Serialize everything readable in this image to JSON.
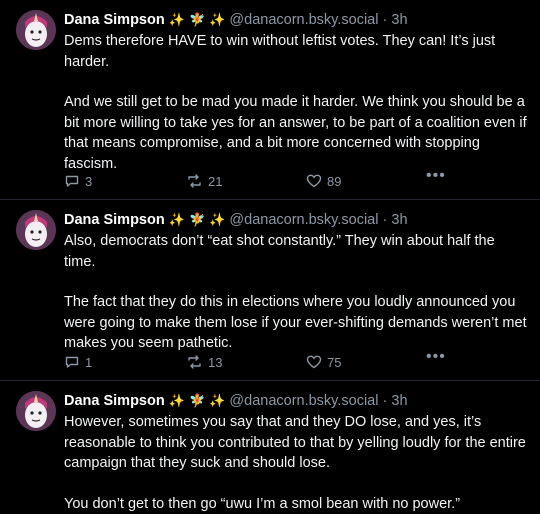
{
  "posts": [
    {
      "name": "Dana Simpson",
      "emoji": [
        "✨",
        "🧚",
        "✨"
      ],
      "handle": "@danacorn.bsky.social",
      "time": "3h",
      "paragraphs": [
        "Dems therefore HAVE to win without leftist votes. They can! It’s just harder.",
        "And we still get to be mad you made it harder. We think you should be a bit more willing to take yes for an answer, to be part of a coalition even if that means compromise, and a bit more concerned with stopping fascism."
      ],
      "replies": "3",
      "reposts": "21",
      "likes": "89"
    },
    {
      "name": "Dana Simpson",
      "emoji": [
        "✨",
        "🧚",
        "✨"
      ],
      "handle": "@danacorn.bsky.social",
      "time": "3h",
      "paragraphs": [
        "Also, democrats don’t “eat shot constantly.” They win about half the time.",
        "The fact that they do this in elections where you loudly announced you were going to make them lose if your ever-shifting demands weren’t met makes you seem pathetic."
      ],
      "replies": "1",
      "reposts": "13",
      "likes": "75"
    },
    {
      "name": "Dana Simpson",
      "emoji": [
        "✨",
        "🧚",
        "✨"
      ],
      "handle": "@danacorn.bsky.social",
      "time": "3h",
      "paragraphs": [
        "However, sometimes you say that and they DO lose, and yes, it’s reasonable to think you contributed to that by yelling loudly for the entire campaign that they suck and should lose.",
        "You don’t get to then go “uwu I’m a smol bean with no power.”"
      ]
    }
  ],
  "more_label": "•••",
  "separator": "·",
  "colors": {
    "background": "#000000",
    "text": "#ffffff",
    "muted": "#8b98a5",
    "divider": "#23272e"
  }
}
